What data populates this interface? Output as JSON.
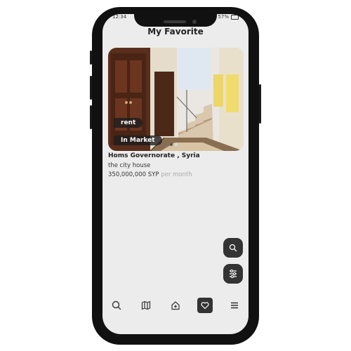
{
  "status_bar": {
    "time": "12:34",
    "battery": "57%"
  },
  "page": {
    "title": "My Favorite"
  },
  "listing": {
    "badges": {
      "type": "rent",
      "state": "In Market"
    },
    "location": "Homs Governorate , Syria",
    "name": "the city house",
    "price": "350,000,000 SYP",
    "price_period": "per month",
    "carousel_dots": 2,
    "carousel_active_index": 0
  },
  "floating_buttons": [
    "search-icon",
    "filter-sliders-icon"
  ],
  "navbar": {
    "items": [
      "search-icon",
      "map-icon",
      "home-add-icon",
      "heart-icon",
      "menu-icon"
    ],
    "active_index": 3
  },
  "colors": {
    "accent": "#333333",
    "screen_bg": "#ececec",
    "frame": "#111111"
  }
}
